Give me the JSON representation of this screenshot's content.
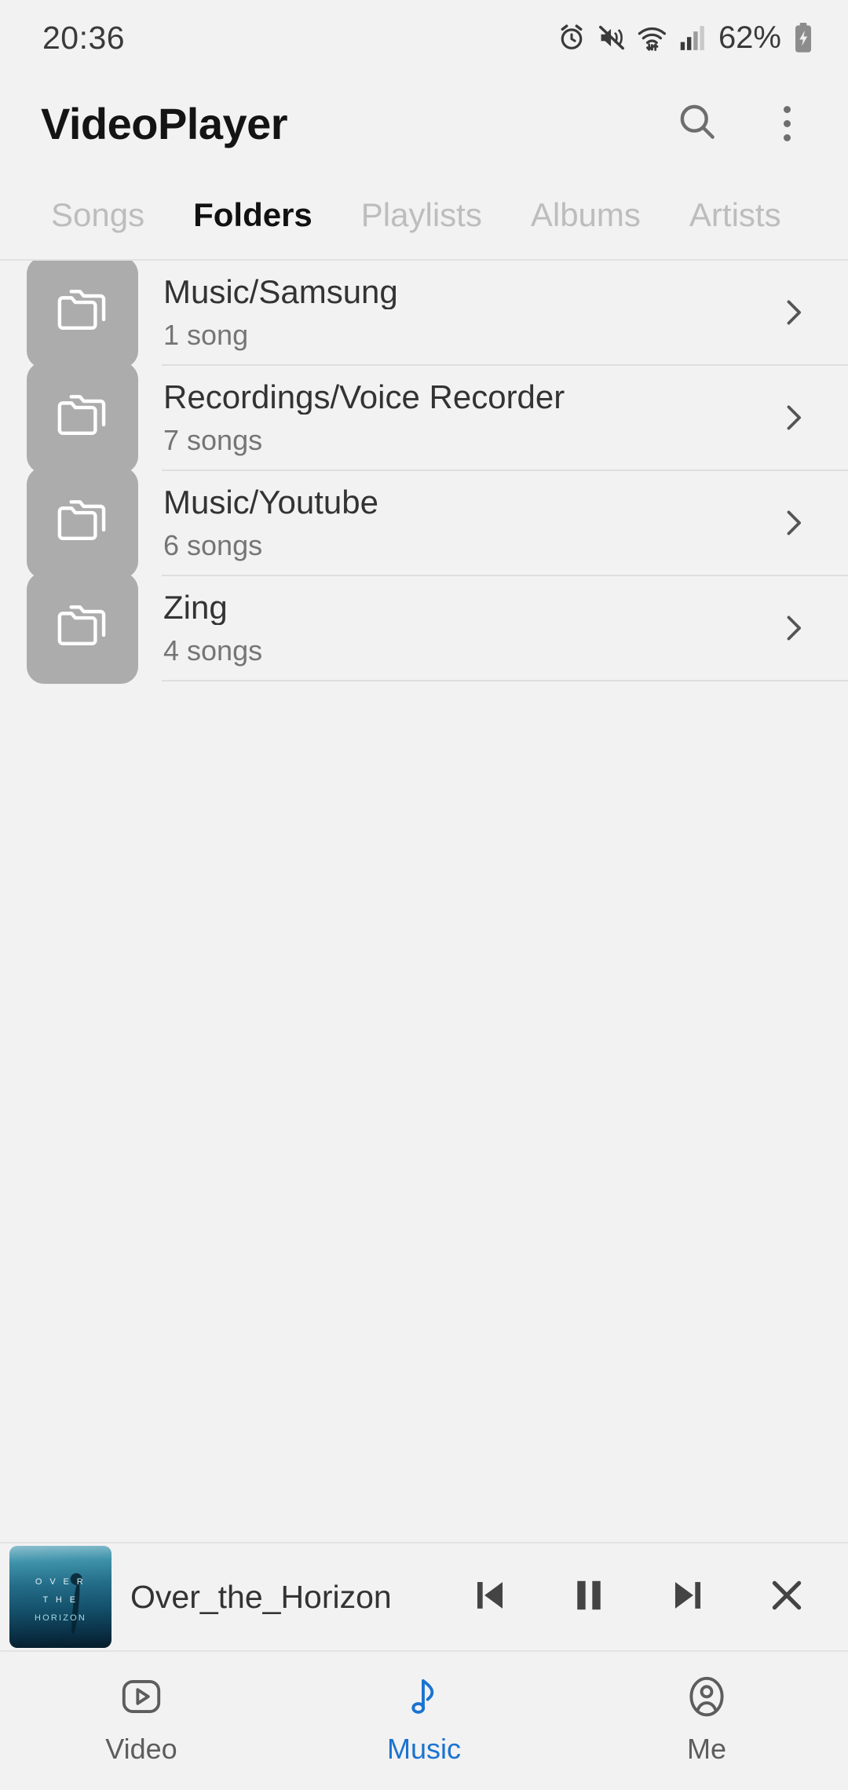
{
  "status_bar": {
    "time": "20:36",
    "battery_percent": "62%",
    "icons": [
      "alarm-icon",
      "mute-vibrate-icon",
      "wifi-icon",
      "signal-icon",
      "battery-charging-icon"
    ]
  },
  "app_bar": {
    "title": "VideoPlayer",
    "search_icon": "search-icon",
    "overflow_icon": "overflow-menu-icon"
  },
  "tabs": {
    "active": "Folders",
    "items": [
      {
        "label": "Songs"
      },
      {
        "label": "Folders"
      },
      {
        "label": "Playlists"
      },
      {
        "label": "Albums"
      },
      {
        "label": "Artists"
      }
    ]
  },
  "folder_list": [
    {
      "title": "Music/Samsung",
      "count": "1 song",
      "icon": "folder-icon",
      "chevron": "chevron-right-icon"
    },
    {
      "title": "Recordings/Voice Recorder",
      "count": "7 songs",
      "icon": "folder-icon",
      "chevron": "chevron-right-icon"
    },
    {
      "title": "Music/Youtube",
      "count": "6 songs",
      "icon": "folder-icon",
      "chevron": "chevron-right-icon"
    },
    {
      "title": "Zing",
      "count": "4 songs",
      "icon": "folder-icon",
      "chevron": "chevron-right-icon"
    }
  ],
  "mini_player": {
    "track_title": "Over_the_Horizon",
    "album_art_text": [
      "O V E R",
      "T H E",
      "HORIZON"
    ],
    "controls": [
      {
        "name": "previous-button",
        "icon": "skip-previous-icon"
      },
      {
        "name": "pause-button",
        "icon": "pause-icon"
      },
      {
        "name": "next-button",
        "icon": "skip-next-icon"
      },
      {
        "name": "close-button",
        "icon": "close-icon"
      }
    ]
  },
  "bottom_nav": {
    "active": "Music",
    "active_color": "#1a73d0",
    "items": [
      {
        "label": "Video",
        "icon": "video-play-icon"
      },
      {
        "label": "Music",
        "icon": "music-note-icon"
      },
      {
        "label": "Me",
        "icon": "account-icon"
      }
    ]
  }
}
